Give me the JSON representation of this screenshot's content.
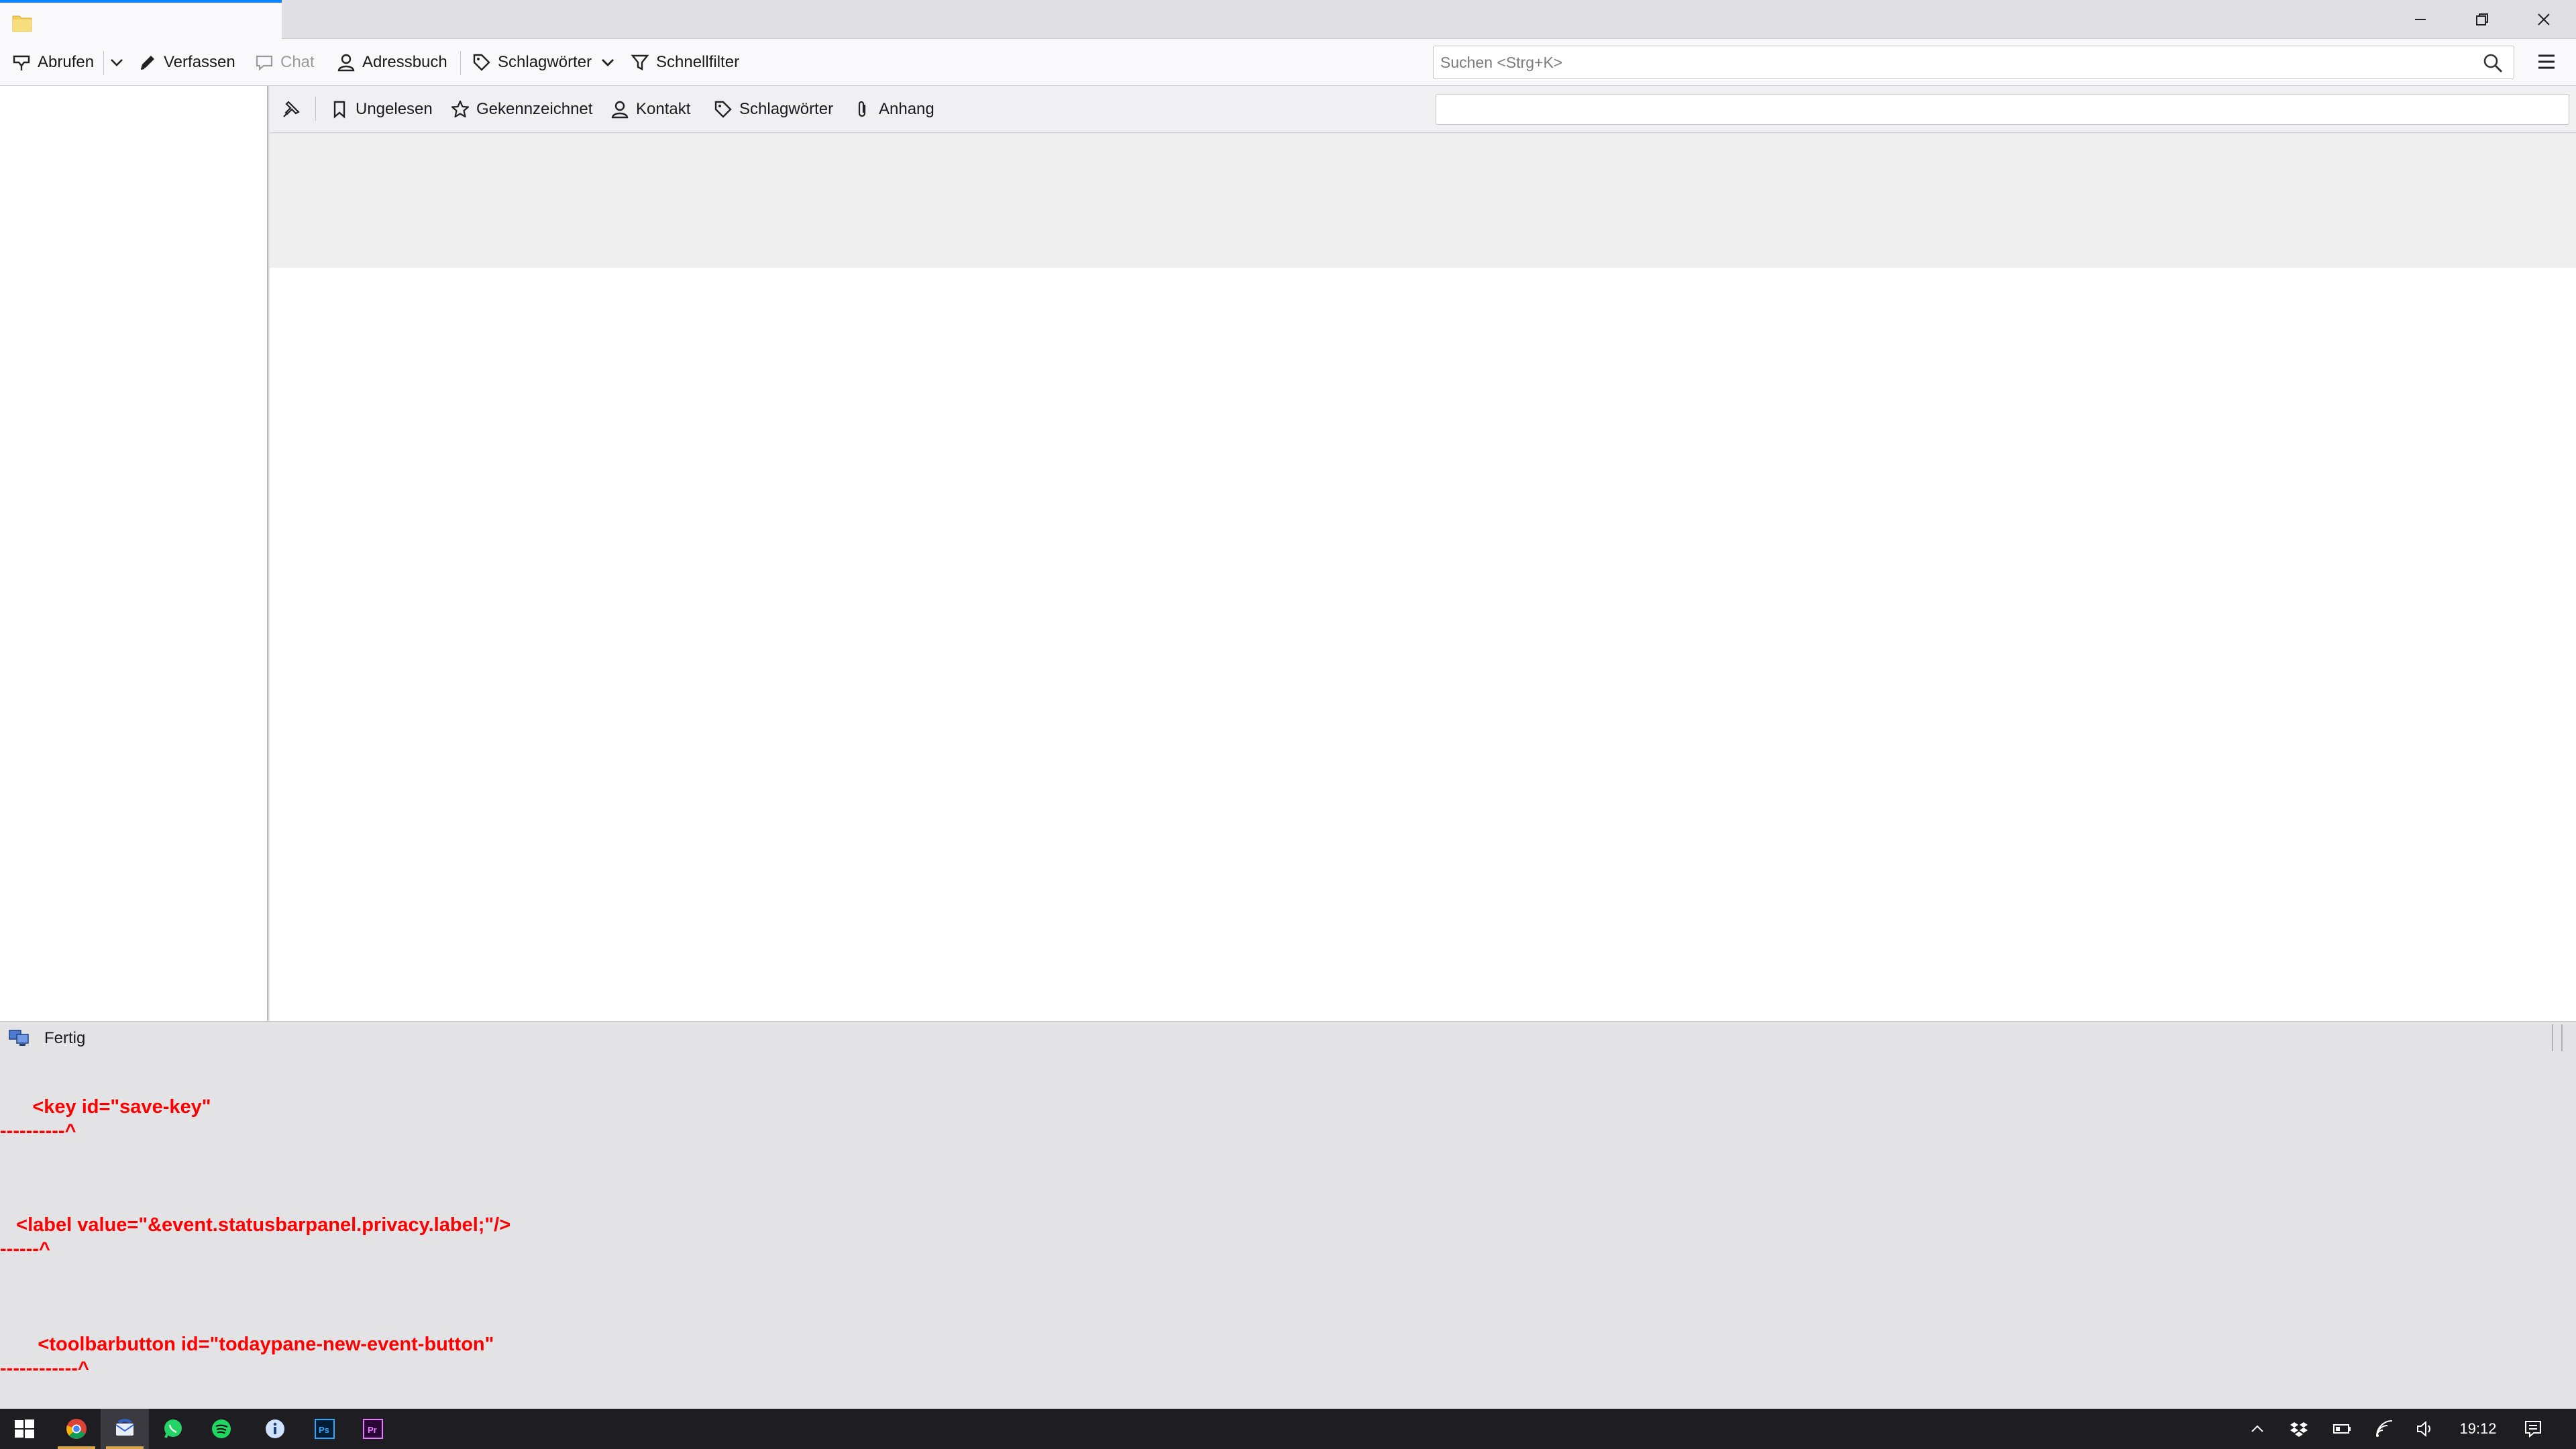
{
  "toolbar": {
    "get_messages": "Abrufen",
    "compose": "Verfassen",
    "chat": "Chat",
    "address_book": "Adressbuch",
    "tags": "Schlagwörter",
    "quick_filter": "Schnellfilter",
    "search_placeholder": "Suchen <Strg+K>"
  },
  "quick_filter_bar": {
    "unread": "Ungelesen",
    "starred": "Gekennzeichnet",
    "contact": "Kontakt",
    "tags": "Schlagwörter",
    "attachment": "Anhang"
  },
  "statusbar": {
    "text": "Fertig"
  },
  "errors": [
    {
      "line": "      <key id=\"save-key\"",
      "pointer": "----------^"
    },
    {
      "line": "   <label value=\"&event.statusbarpanel.privacy.label;\"/>",
      "pointer": "------^"
    },
    {
      "line": "       <toolbarbutton id=\"todaypane-new-event-button\"",
      "pointer": "------------^"
    }
  ],
  "taskbar": {
    "clock": "19:12"
  },
  "colors": {
    "accent": "#0a84ff",
    "error_text": "#ff0000"
  }
}
